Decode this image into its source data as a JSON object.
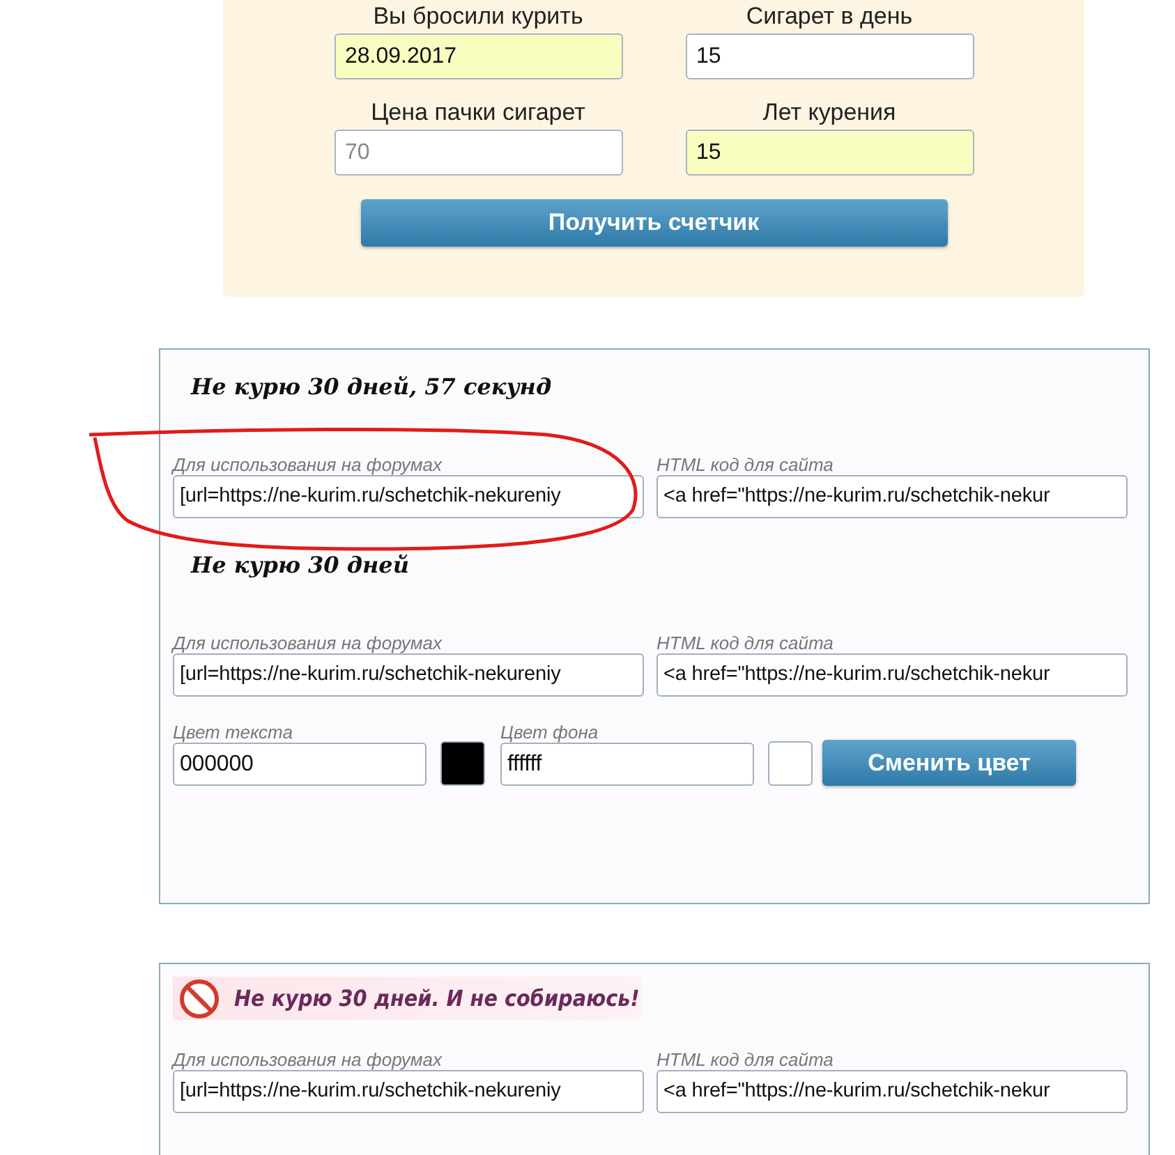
{
  "form": {
    "fields": [
      {
        "label": "Вы бросили курить",
        "value": "28.09.2017",
        "autofilled": true
      },
      {
        "label": "Сигарет в день",
        "value": "15",
        "autofilled": false
      },
      {
        "label": "Цена пачки сигарет",
        "placeholder": "70",
        "autofilled": false
      },
      {
        "label": "Лет курения",
        "value": "15",
        "autofilled": true
      }
    ],
    "button": "Получить счетчик"
  },
  "counter_card": {
    "blocks": [
      {
        "title": "Не курю  30 дней, 57 секунд",
        "forum_label": "Для использования на форумах",
        "forum_code": "[url=https://ne-kurim.ru/schetchik-nekureniy",
        "html_label": "HTML код для сайта",
        "html_code": "<a href=\"https://ne-kurim.ru/schetchik-nekur"
      },
      {
        "title": "Не курю  30 дней",
        "forum_label": "Для использования на форумах",
        "forum_code": "[url=https://ne-kurim.ru/schetchik-nekureniy",
        "html_label": "HTML код для сайта",
        "html_code": "<a href=\"https://ne-kurim.ru/schetchik-nekur"
      }
    ],
    "colors": [
      {
        "label": "Цвет текста",
        "value": "000000",
        "color": "#000000"
      },
      {
        "label": "Цвет фона",
        "value": "ffffff",
        "color": "#ffffff"
      }
    ],
    "button": "Сменить цвет"
  },
  "banner_card": {
    "title": "Не курю 30 дней. И не собираюсь!",
    "forum_label": "Для использования на форумах",
    "forum_code": "[url=https://ne-kurim.ru/schetchik-nekureniy",
    "html_label": "HTML код для сайта",
    "html_code": "<a href=\"https://ne-kurim.ru/schetchik-nekur"
  }
}
